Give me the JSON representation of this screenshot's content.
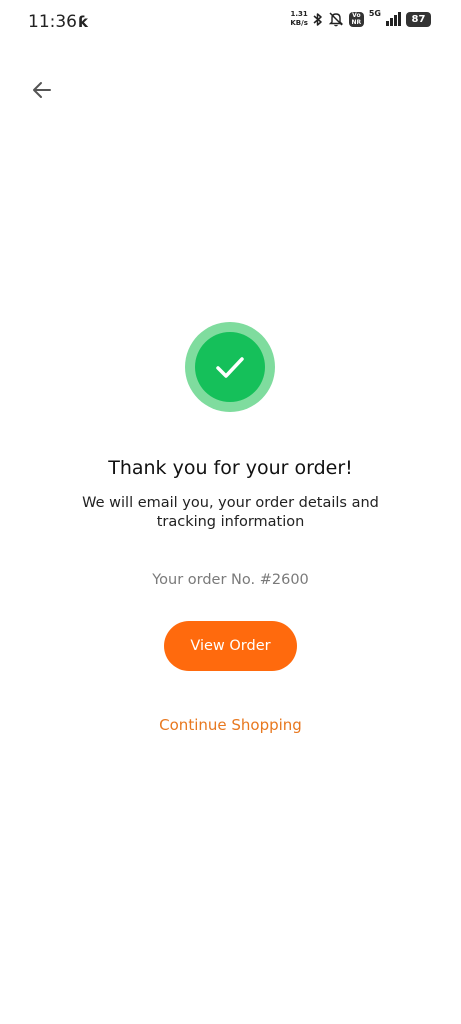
{
  "status_bar": {
    "time": "11:36",
    "app_icon": "ƙ",
    "net_speed_value": "1.31",
    "net_speed_unit": "KB/s",
    "volte_top": "Vo",
    "volte_bottom": "NR",
    "network": "5G",
    "battery": "87"
  },
  "header": {
    "back_icon": "arrow-left-icon"
  },
  "confirmation": {
    "title": "Thank you for your order!",
    "message": "We will email you, your order details and tracking information",
    "order_number": "Your order No. #2600",
    "view_order_label": "View Order",
    "continue_label": "Continue Shopping"
  },
  "colors": {
    "accent_orange": "#ff6a0d",
    "link_orange": "#e8781f",
    "success_green": "#15c05a",
    "success_ring": "#7fdc9e"
  }
}
